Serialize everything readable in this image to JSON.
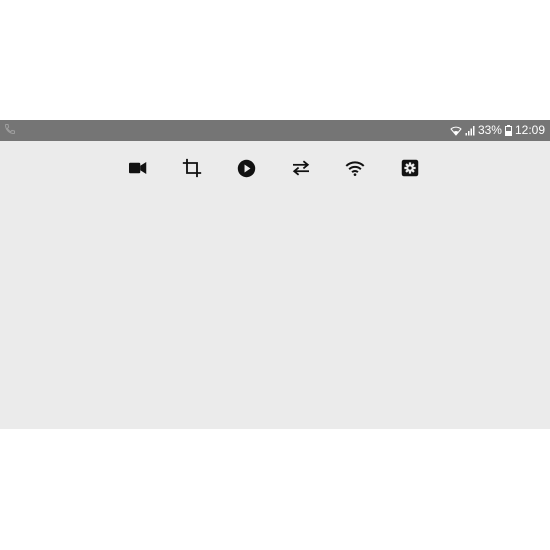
{
  "status_bar": {
    "battery_percent": "33%",
    "time": "12:09",
    "left_icon": "phone-call-icon",
    "right_icons": [
      "wifi-icon",
      "cell-signal-icon",
      "battery-icon"
    ]
  },
  "toolbar": {
    "buttons": [
      {
        "icon": "video-camera-icon"
      },
      {
        "icon": "crop-icon"
      },
      {
        "icon": "play-circle-icon"
      },
      {
        "icon": "swap-arrows-icon"
      },
      {
        "icon": "wifi-icon"
      },
      {
        "icon": "settings-icon"
      }
    ]
  },
  "colors": {
    "status_bar_bg": "#757575",
    "screen_bg": "#ebebeb",
    "icon": "#111111"
  }
}
